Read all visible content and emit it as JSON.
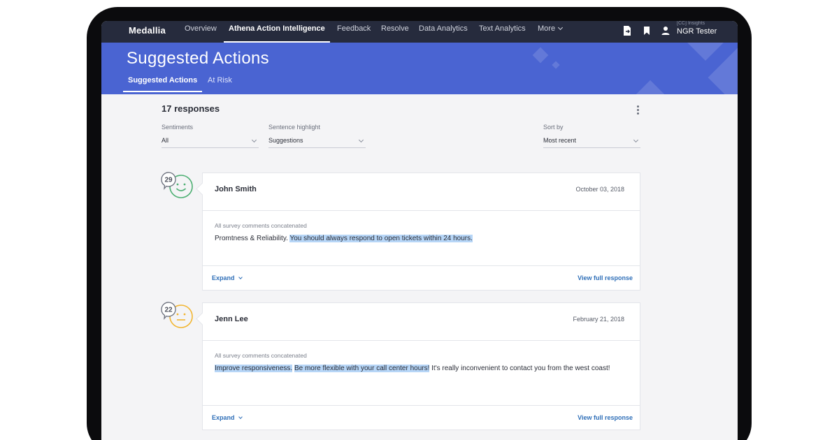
{
  "nav": {
    "brand": "Medallia",
    "items": [
      "Overview",
      "Athena Action Intelligence",
      "Feedback",
      "Resolve",
      "Data Analytics",
      "Text Analytics",
      "More"
    ],
    "active_index": 1,
    "icons": [
      "export-icon",
      "bookmark-icon",
      "user-icon"
    ],
    "user_org": "[CC] Insights",
    "user_name": "NGR Tester"
  },
  "header": {
    "title": "Suggested Actions",
    "tabs": [
      "Suggested Actions",
      "At Risk"
    ],
    "active_tab": 0
  },
  "main": {
    "response_count": "17 responses",
    "filters": [
      {
        "label": "Sentiments",
        "value": "All"
      },
      {
        "label": "Sentence highlight",
        "value": "Suggestions"
      },
      {
        "label": "Sort by",
        "value": "Most recent"
      }
    ],
    "responses": [
      {
        "score": "29",
        "sentiment": "positive",
        "sentiment_color": "#4caf72",
        "name": "John Smith",
        "date": "October 03, 2018",
        "caption": "All survey comments concatenated",
        "text_parts": [
          {
            "text": "Promtness & Reliability. ",
            "hl": false
          },
          {
            "text": "You should always respond to open tickets within 24 hours.",
            "hl": true
          }
        ],
        "expand_label": "Expand",
        "view_label": "View full response"
      },
      {
        "score": "22",
        "sentiment": "neutral",
        "sentiment_color": "#f2b632",
        "name": "Jenn Lee",
        "date": "February 21, 2018",
        "caption": "All survey comments concatenated",
        "text_parts": [
          {
            "text": "Improve responsiveness.",
            "hl": true
          },
          {
            "text": " ",
            "hl": false
          },
          {
            "text": "Be more flexible with your call center hours!",
            "hl": true
          },
          {
            "text": " It's really inconvenient to contact you from the west coast!",
            "hl": false
          }
        ],
        "expand_label": "Expand",
        "view_label": "View full response"
      }
    ]
  },
  "colors": {
    "nav_bg": "#262b3d",
    "header_bg": "#4a64d2",
    "link": "#2f6fb8",
    "highlight": "#b7d6f7"
  }
}
